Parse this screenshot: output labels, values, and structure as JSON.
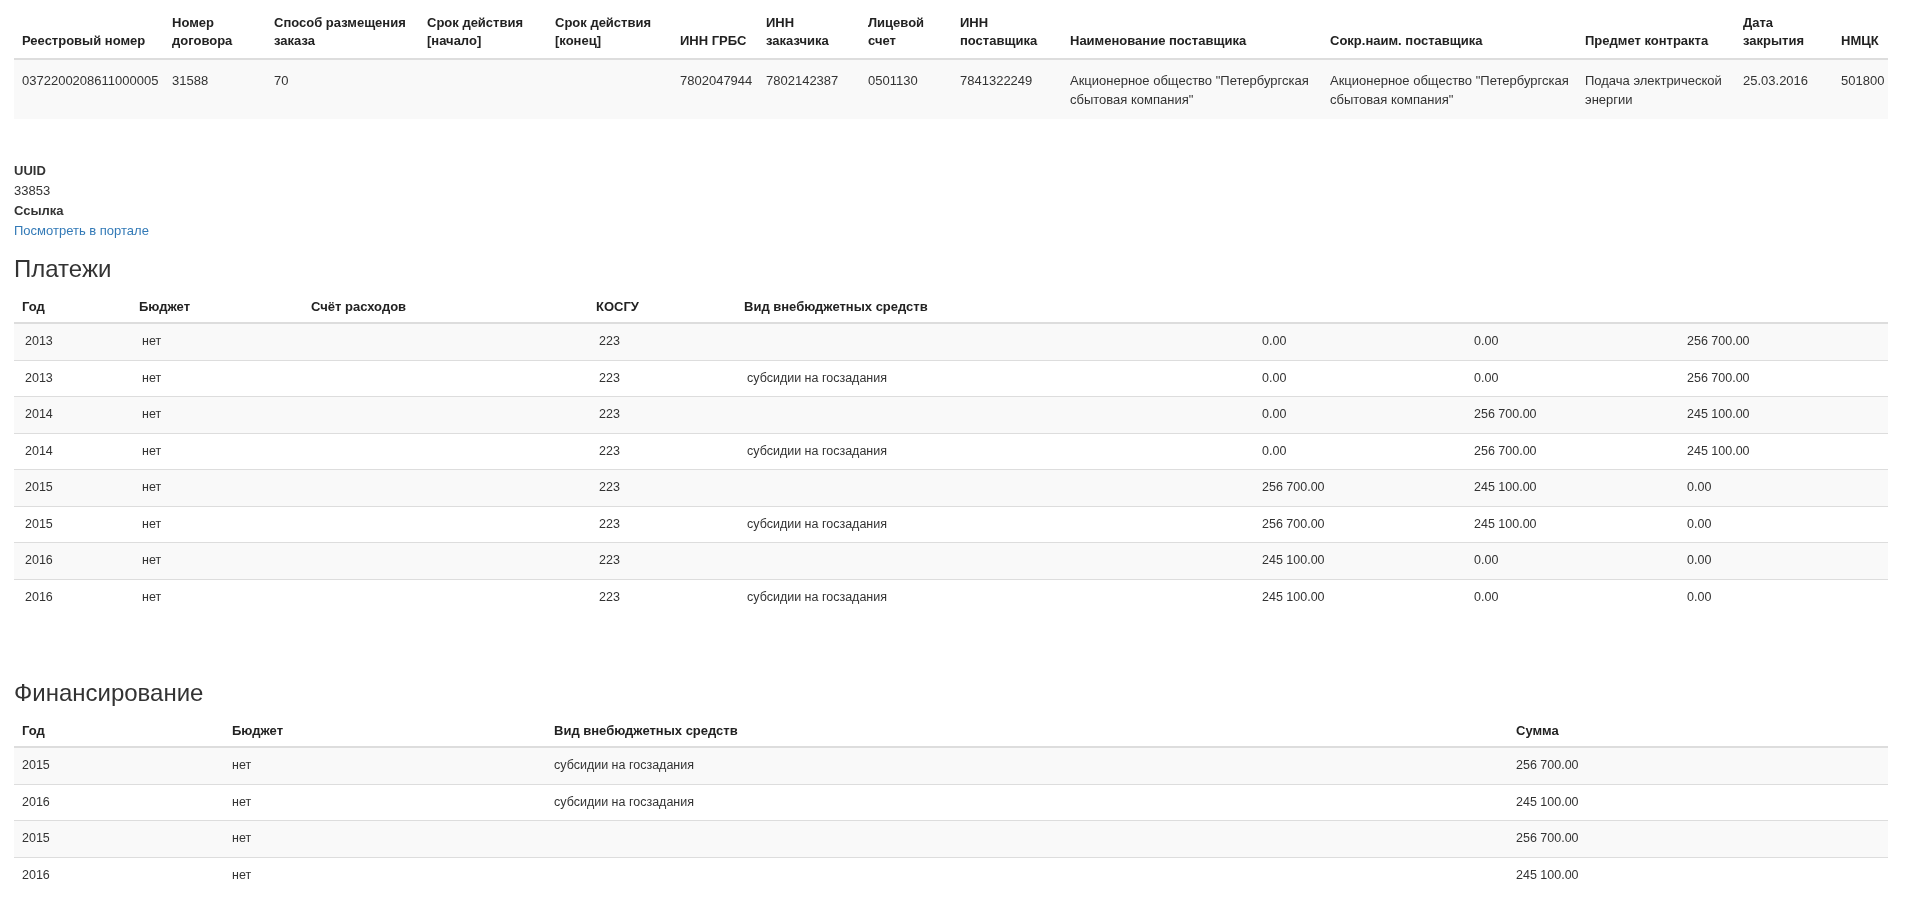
{
  "contract_table": {
    "columns": [
      "Реестровый номер",
      "Номер договора",
      "Способ размещения заказа",
      "Срок действия [начало]",
      "Срок действия [конец]",
      "ИНН ГРБС",
      "ИНН заказчика",
      "Лицевой счет",
      "ИНН поставщика",
      "Наименование поставщика",
      "Сокр.наим. поставщика",
      "Предмет контракта",
      "Дата закрытия",
      "НМЦК"
    ],
    "rows": [
      [
        "0372200208611000005",
        "31588",
        "70",
        null,
        null,
        "7802047944",
        "7802142387",
        "0501130",
        "7841322249",
        "Акционерное общество \"Петербургская сбытовая компания\"",
        "Акционерное общество \"Петербургская сбытовая компания\"",
        "Подача электрической энергии",
        "25.03.2016",
        "501800"
      ]
    ]
  },
  "details": [
    {
      "label": "UUID",
      "value": "33853",
      "kind": "text"
    },
    {
      "label": "Ссылка",
      "value": "Посмотреть в портале",
      "kind": "link"
    }
  ],
  "payments": {
    "title": "Платежи",
    "columns": [
      "Год",
      "Бюджет",
      "Счёт расходов",
      "КОСГУ",
      "Вид внебюджетных средств",
      null,
      null,
      null
    ],
    "rows": [
      [
        "2013",
        "нет",
        null,
        "223",
        null,
        "0.00",
        "0.00",
        "256 700.00"
      ],
      [
        "2013",
        "нет",
        null,
        "223",
        "субсидии на госзадания",
        "0.00",
        "0.00",
        "256 700.00"
      ],
      [
        "2014",
        "нет",
        null,
        "223",
        null,
        "0.00",
        "256 700.00",
        "245 100.00"
      ],
      [
        "2014",
        "нет",
        null,
        "223",
        "субсидии на госзадания",
        "0.00",
        "256 700.00",
        "245 100.00"
      ],
      [
        "2015",
        "нет",
        null,
        "223",
        null,
        "256 700.00",
        "245 100.00",
        "0.00"
      ],
      [
        "2015",
        "нет",
        null,
        "223",
        "субсидии на госзадания",
        "256 700.00",
        "245 100.00",
        "0.00"
      ],
      [
        "2016",
        "нет",
        null,
        "223",
        null,
        "245 100.00",
        "0.00",
        "0.00"
      ],
      [
        "2016",
        "нет",
        null,
        "223",
        "субсидии на госзадания",
        "245 100.00",
        "0.00",
        "0.00"
      ]
    ]
  },
  "financing": {
    "title": "Финансирование",
    "columns": [
      "Год",
      "Бюджет",
      "Вид внебюджетных средств",
      "Сумма"
    ],
    "rows": [
      [
        "2015",
        "нет",
        "субсидии на госзадания",
        "256 700.00"
      ],
      [
        "2016",
        "нет",
        "субсидии на госзадания",
        "245 100.00"
      ],
      [
        "2015",
        "нет",
        null,
        "256 700.00"
      ],
      [
        "2016",
        "нет",
        null,
        "245 100.00"
      ]
    ]
  }
}
